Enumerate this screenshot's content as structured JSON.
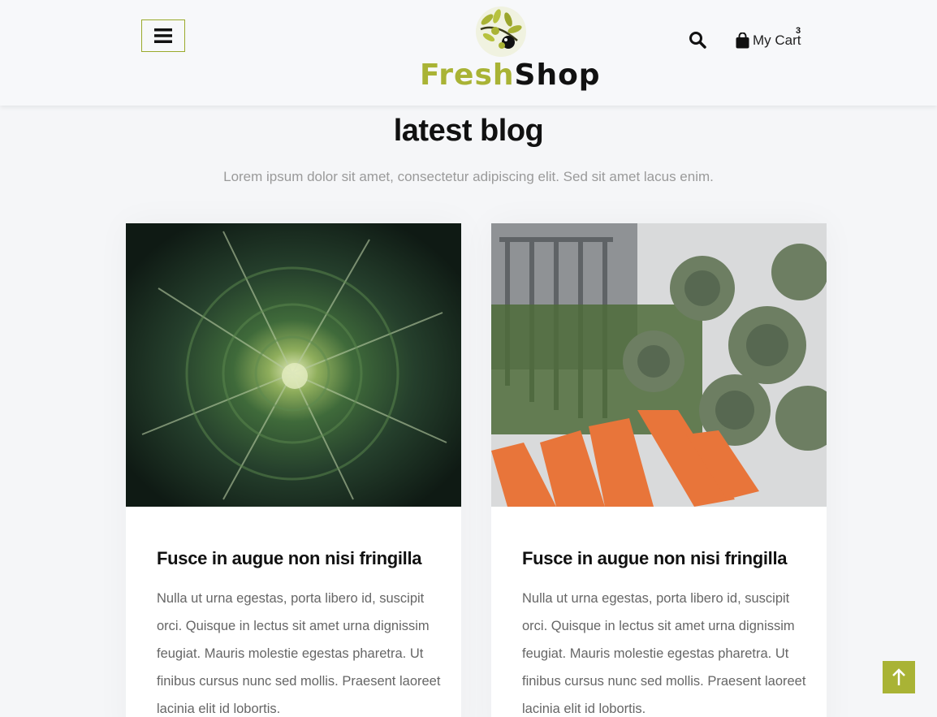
{
  "header": {
    "logo": {
      "part1": "Fresh",
      "part2": "Shop"
    },
    "cart": {
      "label": "My Cart",
      "count": "3"
    },
    "icons": {
      "menu": "hamburger-icon",
      "search": "search-icon",
      "cart": "shopping-bag-icon"
    }
  },
  "section": {
    "title": "latest blog",
    "subtitle": "Lorem ipsum dolor sit amet, consectetur adipiscing elit. Sed sit amet lacus enim."
  },
  "posts": [
    {
      "image": "cabbage-photo",
      "title": "Fusce in augue non nisi fringilla",
      "text": "Nulla ut urna egestas, porta libero id, suscipit orci. Quisque in lectus sit amet urna dignissim feugiat. Mauris molestie egestas pharetra. Ut finibus cursus nunc sed mollis. Praesent laoreet lacinia elit id lobortis."
    },
    {
      "image": "artichokes-carrots-photo",
      "title": "Fusce in augue non nisi fringilla",
      "text": "Nulla ut urna egestas, porta libero id, suscipit orci. Quisque in lectus sit amet urna dignissim feugiat. Mauris molestie egestas pharetra. Ut finibus cursus nunc sed mollis. Praesent laoreet lacinia elit id lobortis."
    }
  ],
  "scroll_top": {
    "icon": "arrow-up-icon"
  },
  "colors": {
    "accent": "#a9b335",
    "text_dark": "#111111",
    "text_muted": "#666666",
    "page_bg": "#f5f6f8"
  }
}
